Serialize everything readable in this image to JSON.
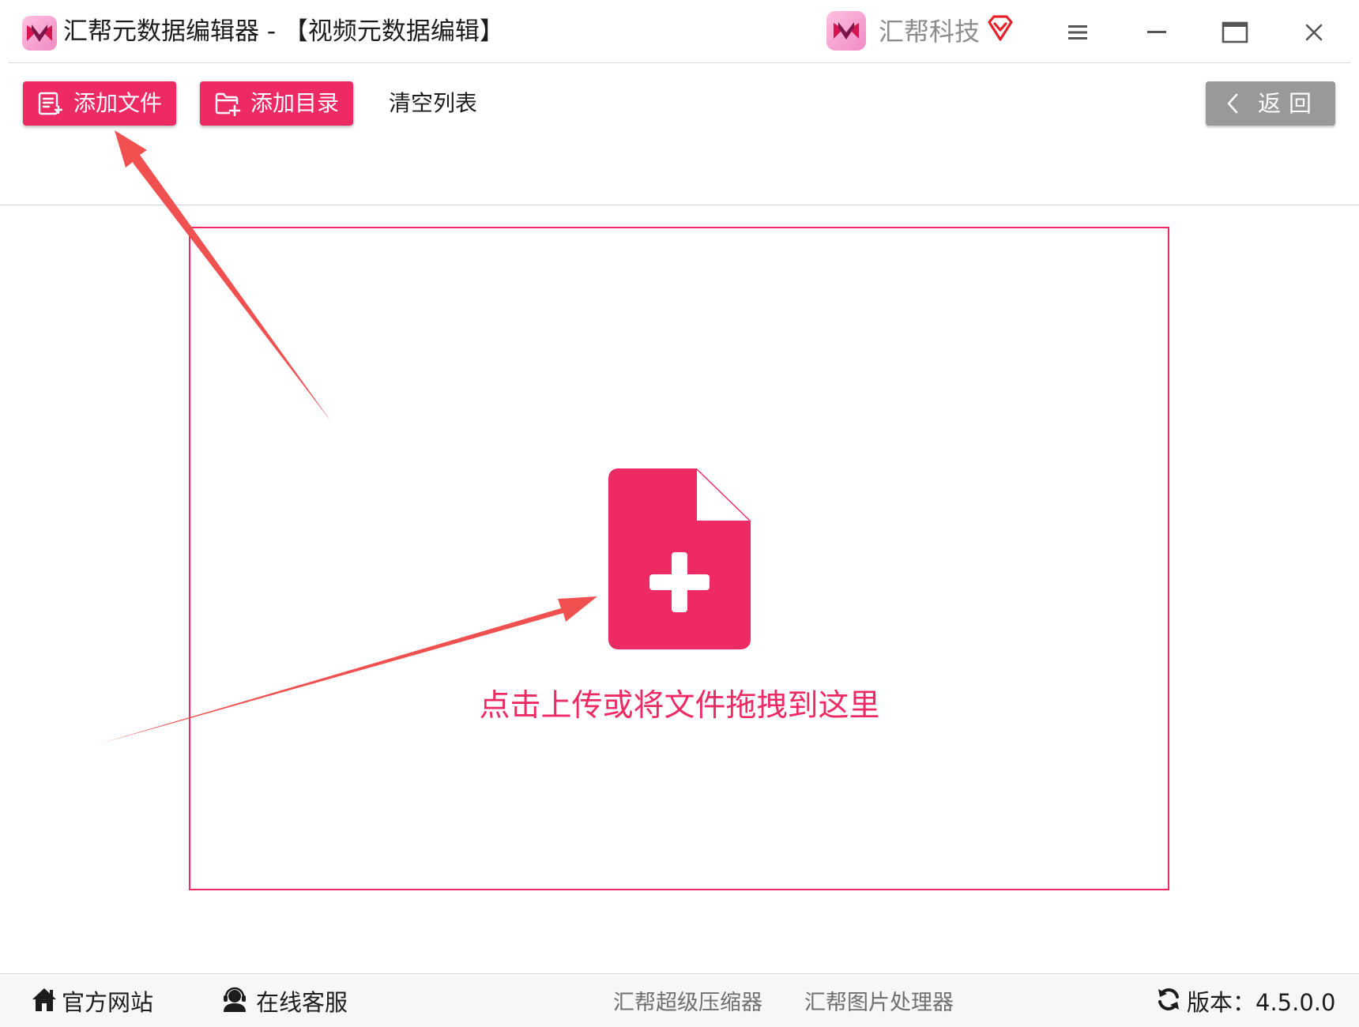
{
  "window": {
    "title": "汇帮元数据编辑器 - 【视频元数据编辑】",
    "brand_name": "汇帮科技",
    "icons": [
      "app-logo-icon",
      "brand-logo-icon",
      "vip-diamond-icon",
      "menu-icon",
      "minimize-icon",
      "maximize-icon",
      "close-icon"
    ]
  },
  "toolbar": {
    "add_file_label": "添加文件",
    "add_dir_label": "添加目录",
    "clear_list_label": "清空列表",
    "back_label": "返回"
  },
  "dropzone": {
    "hint": "点击上传或将文件拖拽到这里",
    "icon": "file-plus-icon"
  },
  "statusbar": {
    "website_label": "官方网站",
    "support_label": "在线客服",
    "compressor_label": "汇帮超级压缩器",
    "image_processor_label": "汇帮图片处理器",
    "version_label": "版本：4.5.0.0"
  },
  "colors": {
    "accent": "#ee2a64",
    "back_button": "#999999",
    "annotation_arrow": "#f05050",
    "vip_red": "#e6212a"
  }
}
